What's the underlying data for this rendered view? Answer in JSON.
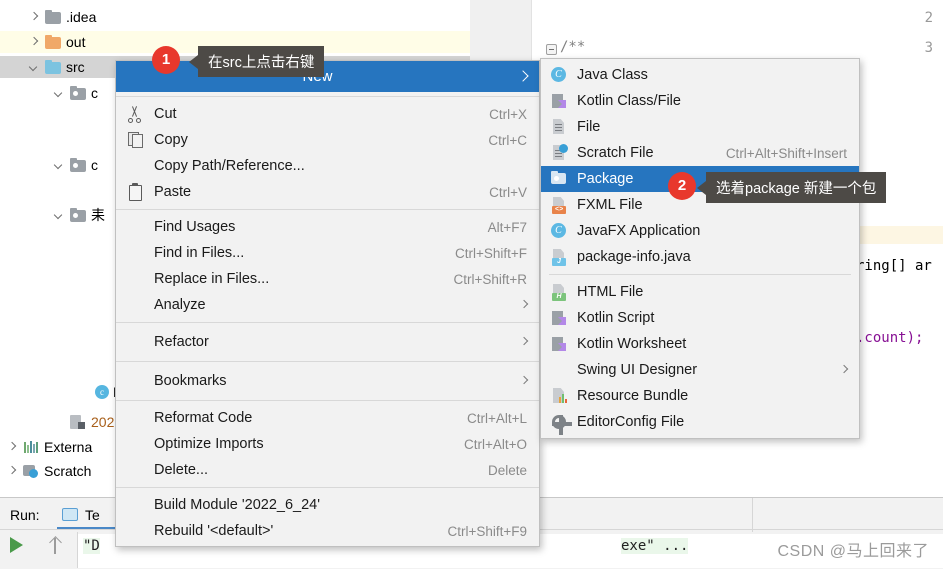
{
  "editor": {
    "line_numbers": [
      "2",
      "3"
    ],
    "code_fragments": [
      {
        "text": "/**",
        "kind": "comment"
      },
      {
        "text": "ring[] ar",
        "kind": "plain"
      },
      {
        "text": ".count);",
        "kind": "field"
      }
    ]
  },
  "tree": {
    "items": [
      {
        "label": ".idea",
        "icon": "folder-icon",
        "arrow": "collapsed",
        "color": "#9aa0a6",
        "highlight": "none",
        "indent": 30
      },
      {
        "label": "out",
        "icon": "folder-icon",
        "arrow": "collapsed",
        "color": "#f0a868",
        "highlight": "yellow",
        "indent": 30
      },
      {
        "label": "src",
        "icon": "folder-icon",
        "arrow": "expanded",
        "color": "#7cc3e0",
        "highlight": "grey",
        "indent": 30
      },
      {
        "label": "c",
        "icon": "package-icon",
        "arrow": "expanded",
        "color": "#9aa0a6",
        "highlight": "none",
        "indent": 55
      },
      {
        "label": "",
        "icon": "java-class-icon",
        "arrow": "none",
        "color": "#56b6e0",
        "highlight": "none",
        "indent": 100
      },
      {
        "label": "",
        "icon": "java-class-icon",
        "arrow": "none",
        "color": "#56b6e0",
        "highlight": "none",
        "indent": 100
      },
      {
        "label": "c",
        "icon": "package-icon",
        "arrow": "expanded",
        "color": "#9aa0a6",
        "highlight": "none",
        "indent": 55
      },
      {
        "label": "",
        "icon": "java-class-icon",
        "arrow": "none",
        "color": "#56b6e0",
        "highlight": "none",
        "indent": 100
      },
      {
        "label": "耒",
        "icon": "package-icon",
        "arrow": "expanded",
        "color": "#9aa0a6",
        "highlight": "none",
        "indent": 55
      },
      {
        "label": "",
        "icon": "java-class-icon",
        "arrow": "none",
        "color": "#56b6e0",
        "highlight": "none",
        "indent": 100
      },
      {
        "label": "",
        "icon": "java-class-icon",
        "arrow": "none",
        "color": "#56b6e0",
        "highlight": "none",
        "indent": 100
      },
      {
        "label": "D",
        "icon": "java-class-icon",
        "arrow": "none",
        "color": "#56b6e0",
        "highlight": "none",
        "indent": 80
      },
      {
        "label": "202",
        "icon": "module-icon",
        "arrow": "none",
        "color": "#a85f1a",
        "highlight": "none",
        "indent": 55
      },
      {
        "label": "Externa",
        "icon": "external-libraries-icon",
        "arrow": "collapsed",
        "color": "#2a8a5c",
        "highlight": "none",
        "indent": 8
      },
      {
        "label": "Scratch",
        "icon": "scratches-icon",
        "arrow": "collapsed",
        "color": "#389fd6",
        "highlight": "none",
        "indent": 8
      }
    ]
  },
  "context_menu": {
    "new_label": "New",
    "items": [
      {
        "label": "Cut",
        "accel": "Ctrl+X",
        "icon": "cut-icon",
        "submenu": false,
        "mnemonic_index": 2
      },
      {
        "label": "Copy",
        "accel": "Ctrl+C",
        "icon": "copy-icon",
        "submenu": false,
        "mnemonic_index": 0
      },
      {
        "label": "Copy Path/Reference...",
        "accel": "",
        "icon": "",
        "submenu": false,
        "mnemonic_index": -1
      },
      {
        "label": "Paste",
        "accel": "Ctrl+V",
        "icon": "paste-icon",
        "submenu": false,
        "mnemonic_index": 0
      },
      {
        "divider": true
      },
      {
        "label": "Find Usages",
        "accel": "Alt+F7",
        "icon": "",
        "submenu": false,
        "mnemonic_index": 5
      },
      {
        "label": "Find in Files...",
        "accel": "Ctrl+Shift+F",
        "icon": "",
        "submenu": false,
        "mnemonic_index": -1
      },
      {
        "label": "Replace in Files...",
        "accel": "Ctrl+Shift+R",
        "icon": "",
        "submenu": false,
        "mnemonic_index": 4
      },
      {
        "label": "Analyze",
        "accel": "",
        "icon": "",
        "submenu": true,
        "mnemonic_index": 5
      },
      {
        "divider": true
      },
      {
        "label": "Refactor",
        "accel": "",
        "icon": "",
        "submenu": true,
        "mnemonic_index": 0
      },
      {
        "divider": true
      },
      {
        "label": "Bookmarks",
        "accel": "",
        "icon": "",
        "submenu": true,
        "mnemonic_index": -1
      },
      {
        "divider": true
      },
      {
        "label": "Reformat Code",
        "accel": "Ctrl+Alt+L",
        "icon": "",
        "submenu": false,
        "mnemonic_index": 0
      },
      {
        "label": "Optimize Imports",
        "accel": "Ctrl+Alt+O",
        "icon": "",
        "submenu": false,
        "mnemonic_index": 6
      },
      {
        "label": "Delete...",
        "accel": "Delete",
        "icon": "",
        "submenu": false,
        "mnemonic_index": 1
      },
      {
        "divider": true
      },
      {
        "label": "Build Module '2022_6_24'",
        "accel": "",
        "icon": "",
        "submenu": false,
        "mnemonic_index": 6
      },
      {
        "label": "Rebuild '<default>'",
        "accel": "Ctrl+Shift+F9",
        "icon": "",
        "submenu": false,
        "mnemonic_index": 1
      }
    ]
  },
  "new_submenu": {
    "items": [
      {
        "label": "Java Class",
        "accel": "",
        "icon": "java-class-icon",
        "selected": false,
        "submenu": false
      },
      {
        "label": "Kotlin Class/File",
        "accel": "",
        "icon": "kotlin-icon",
        "selected": false,
        "submenu": false
      },
      {
        "label": "File",
        "accel": "",
        "icon": "file-icon",
        "selected": false,
        "submenu": false
      },
      {
        "label": "Scratch File",
        "accel": "Ctrl+Alt+Shift+Insert",
        "icon": "scratch-file-icon",
        "selected": false,
        "submenu": false
      },
      {
        "label": "Package",
        "accel": "",
        "icon": "package-icon",
        "selected": true,
        "submenu": false
      },
      {
        "label": "FXML File",
        "accel": "",
        "icon": "fxml-file-icon",
        "selected": false,
        "submenu": false
      },
      {
        "label": "JavaFX Application",
        "accel": "",
        "icon": "javafx-icon",
        "selected": false,
        "submenu": false
      },
      {
        "label": "package-info.java",
        "accel": "",
        "icon": "package-info-icon",
        "selected": false,
        "submenu": false
      },
      {
        "divider": true
      },
      {
        "label": "HTML File",
        "accel": "",
        "icon": "html-file-icon",
        "selected": false,
        "submenu": false
      },
      {
        "label": "Kotlin Script",
        "accel": "",
        "icon": "kotlin-icon",
        "selected": false,
        "submenu": false
      },
      {
        "label": "Kotlin Worksheet",
        "accel": "",
        "icon": "kotlin-icon",
        "selected": false,
        "submenu": false
      },
      {
        "label": "Swing UI Designer",
        "accel": "",
        "icon": "",
        "selected": false,
        "submenu": true
      },
      {
        "label": "Resource Bundle",
        "accel": "",
        "icon": "resource-bundle-icon",
        "selected": false,
        "submenu": false
      },
      {
        "label": "EditorConfig File",
        "accel": "",
        "icon": "gear-icon",
        "selected": false,
        "submenu": false
      }
    ]
  },
  "callouts": [
    {
      "number": "1",
      "text": "在src上点击右键"
    },
    {
      "number": "2",
      "text": "选着package 新建一个包"
    }
  ],
  "run_panel": {
    "label": "Run:",
    "tab_label": "Te",
    "console_text": "\"D",
    "console_text_right": "exe\" ..."
  },
  "watermark": "CSDN @马上回来了",
  "colors": {
    "selection_blue": "#2675bf",
    "badge_red": "#e8382c",
    "tooltip_bg": "#4d4a46",
    "menu_bg": "#f2f2f2"
  }
}
